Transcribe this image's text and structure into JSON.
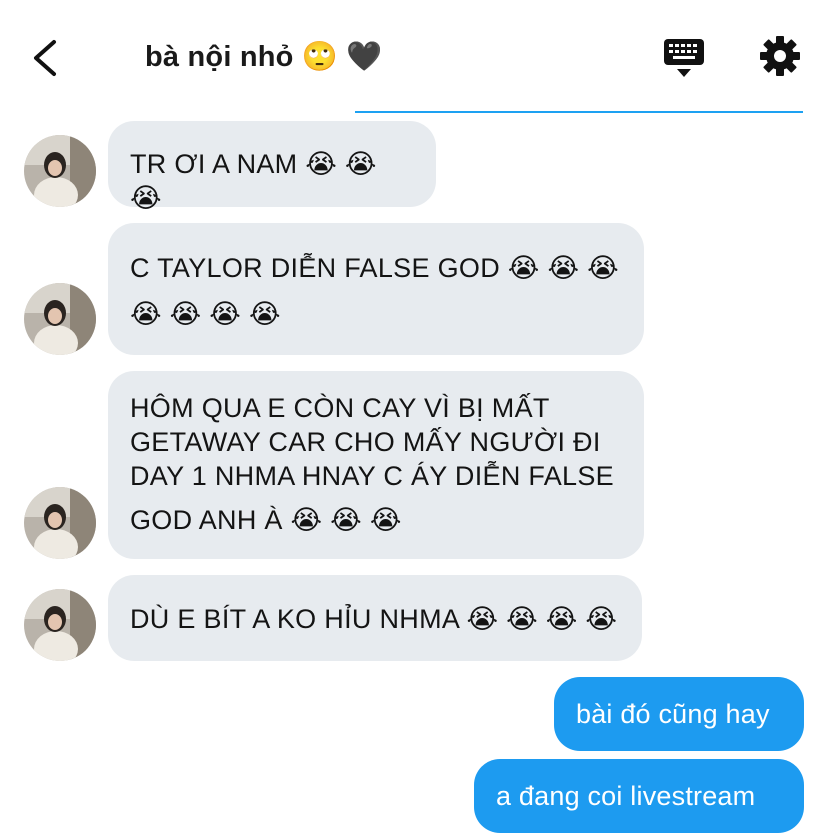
{
  "header": {
    "title": "bà nội nhỏ 🙄 🖤",
    "icons": [
      "back-chevron-icon",
      "keyboard-icon",
      "gear-icon"
    ]
  },
  "colors": {
    "accent": "#1d9bf0",
    "incoming_bubble": "#e7ebef",
    "divider": "#1da1f2"
  },
  "messages": [
    {
      "sender": "other",
      "lines": [
        "TR ƠI A NAM 😭 😭 😭"
      ]
    },
    {
      "sender": "other",
      "lines": [
        "C TAYLOR DIỄN FALSE GOD 😭 😭 😭",
        "😭 😭 😭 😭"
      ]
    },
    {
      "sender": "other",
      "lines": [
        "HÔM QUA E CÒN CAY VÌ BỊ MẤT",
        "GETAWAY CAR CHO MẤY NGƯỜI ĐI",
        "DAY 1 NHMA HNAY C ÁY DIỄN FALSE",
        "GOD ANH À 😭 😭 😭"
      ]
    },
    {
      "sender": "other",
      "lines": [
        "DÙ E BÍT A KO HỈU NHMA 😭 😭 😭 😭"
      ]
    },
    {
      "sender": "me",
      "text": "bài đó cũng hay"
    },
    {
      "sender": "me",
      "text": "a đang coi livestream"
    }
  ]
}
